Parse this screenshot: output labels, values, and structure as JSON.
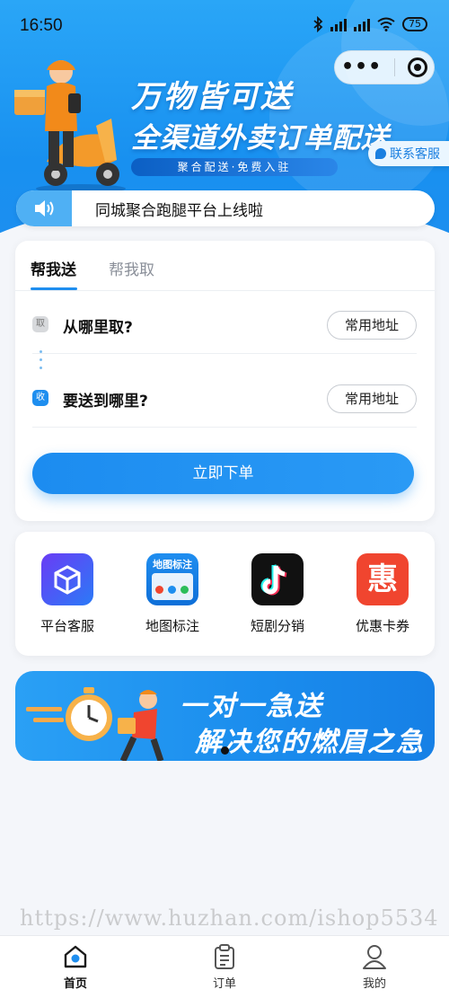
{
  "status_bar": {
    "time": "16:50",
    "battery": "75",
    "icons": [
      "bluetooth-icon",
      "signal-hd-icon",
      "signal-hd-icon",
      "wifi-icon",
      "battery-icon"
    ]
  },
  "banner": {
    "title_line1": "万物皆可送",
    "title_line2": "全渠道外卖订单配送",
    "tagline": "聚合配送·免费入驻",
    "service_label": "联系客服"
  },
  "notice": {
    "text": "同城聚合跑腿平台上线啦"
  },
  "order_card": {
    "tabs": [
      {
        "label": "帮我送",
        "active": true
      },
      {
        "label": "帮我取",
        "active": false
      }
    ],
    "pickup": {
      "badge": "取",
      "label": "从哪里取?",
      "button": "常用地址"
    },
    "dropoff": {
      "badge": "收",
      "label": "要送到哪里?",
      "button": "常用地址"
    },
    "submit_label": "立即下单"
  },
  "menu": {
    "items": [
      {
        "label": "平台客服",
        "icon": "box-icon"
      },
      {
        "label": "地图标注",
        "icon": "map-annotation-icon",
        "icon_text": "地图标注"
      },
      {
        "label": "短剧分销",
        "icon": "tiktok-icon"
      },
      {
        "label": "优惠卡券",
        "icon": "coupon-icon",
        "icon_text": "惠"
      }
    ]
  },
  "promo": {
    "line1": "一对一急送",
    "line2": "解决您的燃眉之急"
  },
  "watermark": "https://www.huzhan.com/ishop5534",
  "tabbar": {
    "items": [
      {
        "label": "首页",
        "icon": "home-icon",
        "active": true
      },
      {
        "label": "订单",
        "icon": "clipboard-icon",
        "active": false
      },
      {
        "label": "我的",
        "icon": "user-icon",
        "active": false
      }
    ]
  },
  "colors": {
    "accent": "#1e8eef",
    "background": "#f4f6fa"
  }
}
